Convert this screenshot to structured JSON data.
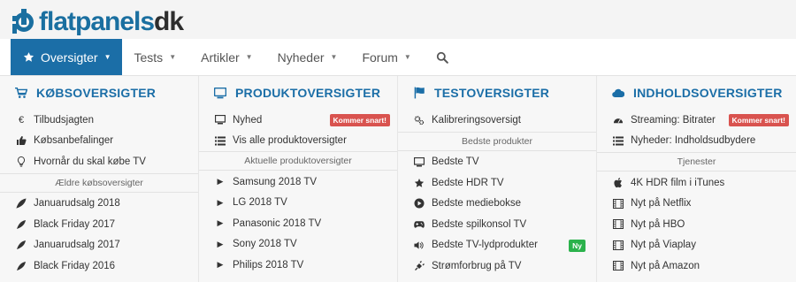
{
  "logo": {
    "brand_blue": "flatpanels",
    "brand_dark": "dk"
  },
  "nav": {
    "items": [
      {
        "label": "Oversigter",
        "icon": "star-icon",
        "active": true
      },
      {
        "label": "Tests"
      },
      {
        "label": "Artikler"
      },
      {
        "label": "Nyheder"
      },
      {
        "label": "Forum"
      }
    ],
    "search_icon": "search-icon"
  },
  "columns": [
    {
      "title": "KØBSOVERSIGTER",
      "icon": "cart-icon",
      "items": [
        {
          "label": "Tilbudsjagten",
          "icon": "euro-icon"
        },
        {
          "label": "Købsanbefalinger",
          "icon": "thumbs-up-icon"
        },
        {
          "label": "Hvornår du skal købe TV",
          "icon": "lightbulb-icon"
        }
      ],
      "sub": "Ældre købsoversigter",
      "sub_items": [
        {
          "label": "Januarudsalg 2018",
          "icon": "leaf-icon"
        },
        {
          "label": "Black Friday 2017",
          "icon": "leaf-icon"
        },
        {
          "label": "Januarudsalg 2017",
          "icon": "leaf-icon"
        },
        {
          "label": "Black Friday 2016",
          "icon": "leaf-icon"
        }
      ]
    },
    {
      "title": "PRODUKTOVERSIGTER",
      "icon": "monitor-icon",
      "items": [
        {
          "label": "Nyhed",
          "icon": "monitor-icon",
          "badge": "Kommer snart!"
        },
        {
          "label": "Vis alle produktoversigter",
          "icon": "list-icon"
        }
      ],
      "sub": "Aktuelle produktoversigter",
      "sub_items": [
        {
          "label": "Samsung 2018 TV",
          "icon": "caret-right-icon"
        },
        {
          "label": "LG 2018 TV",
          "icon": "caret-right-icon"
        },
        {
          "label": "Panasonic 2018 TV",
          "icon": "caret-right-icon"
        },
        {
          "label": "Sony 2018 TV",
          "icon": "caret-right-icon"
        },
        {
          "label": "Philips 2018 TV",
          "icon": "caret-right-icon"
        }
      ]
    },
    {
      "title": "TESTOVERSIGTER",
      "icon": "flag-icon",
      "items": [
        {
          "label": "Kalibreringsoversigt",
          "icon": "cogs-icon"
        }
      ],
      "sub": "Bedste produkter",
      "sub_items": [
        {
          "label": "Bedste TV",
          "icon": "monitor-icon"
        },
        {
          "label": "Bedste HDR TV",
          "icon": "star-icon"
        },
        {
          "label": "Bedste mediebokse",
          "icon": "play-circle-icon"
        },
        {
          "label": "Bedste spilkonsol TV",
          "icon": "gamepad-icon"
        },
        {
          "label": "Bedste TV-lydprodukter",
          "icon": "volume-icon",
          "badge": "Ny"
        },
        {
          "label": "Strømforbrug på TV",
          "icon": "plug-icon"
        }
      ]
    },
    {
      "title": "INDHOLDSOVERSIGTER",
      "icon": "cloud-icon",
      "items": [
        {
          "label": "Streaming: Bitrater",
          "icon": "dashboard-icon",
          "badge": "Kommer snart!"
        },
        {
          "label": "Nyheder: Indholdsudbydere",
          "icon": "list-icon"
        }
      ],
      "sub": "Tjenester",
      "sub_items": [
        {
          "label": "4K HDR film i iTunes",
          "icon": "apple-icon"
        },
        {
          "label": "Nyt på Netflix",
          "icon": "film-icon"
        },
        {
          "label": "Nyt på HBO",
          "icon": "film-icon"
        },
        {
          "label": "Nyt på Viaplay",
          "icon": "film-icon"
        },
        {
          "label": "Nyt på Amazon",
          "icon": "film-icon"
        }
      ]
    }
  ],
  "colors": {
    "accent": "#1b6ea7",
    "badge_red": "#d9534f",
    "badge_green": "#2bb24c"
  }
}
